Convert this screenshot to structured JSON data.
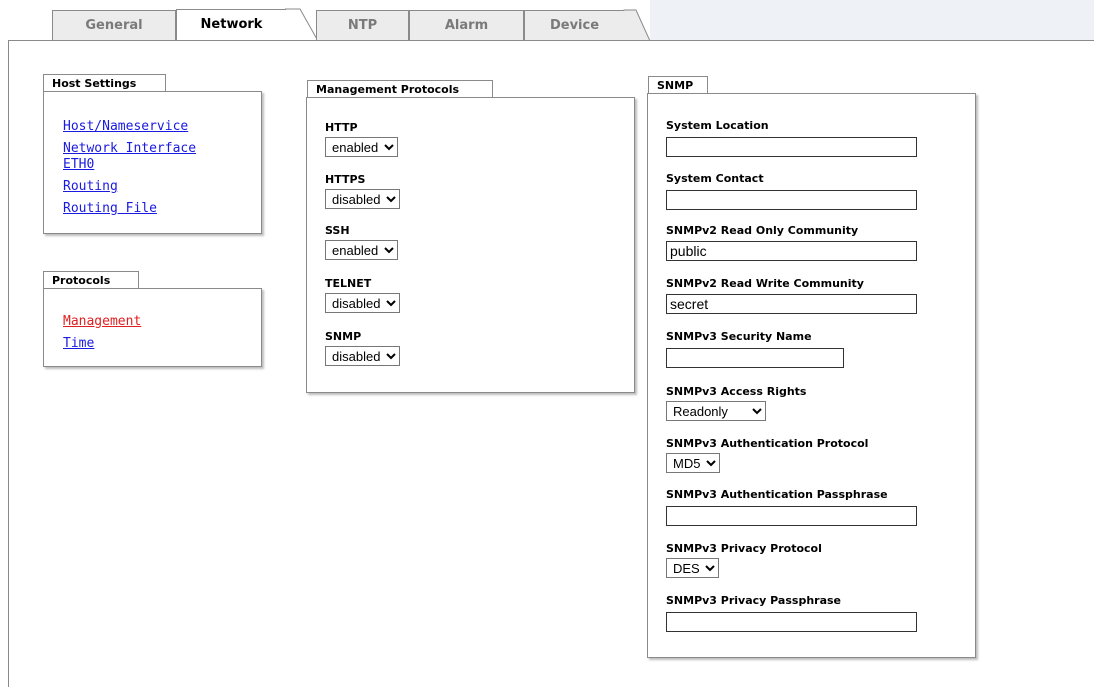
{
  "tabs": [
    {
      "label": "General"
    },
    {
      "label": "Network"
    },
    {
      "label": "NTP"
    },
    {
      "label": "Alarm"
    },
    {
      "label": "Device"
    }
  ],
  "host_settings": {
    "title": "Host Settings",
    "links": [
      "Host/Nameservice",
      "Network Interface",
      "ETH0",
      "Routing",
      "Routing File"
    ]
  },
  "protocols": {
    "title": "Protocols",
    "links": [
      "Management",
      "Time"
    ]
  },
  "management": {
    "title": "Management Protocols",
    "items": [
      {
        "label": "HTTP",
        "value": "enabled"
      },
      {
        "label": "HTTPS",
        "value": "disabled"
      },
      {
        "label": "SSH",
        "value": "enabled"
      },
      {
        "label": "TELNET",
        "value": "disabled"
      },
      {
        "label": "SNMP",
        "value": "disabled"
      }
    ]
  },
  "snmp": {
    "title": "SNMP",
    "system_location": {
      "label": "System Location",
      "value": ""
    },
    "system_contact": {
      "label": "System Contact",
      "value": ""
    },
    "v2_ro": {
      "label": "SNMPv2 Read Only Community",
      "value": "public"
    },
    "v2_rw": {
      "label": "SNMPv2 Read Write Community",
      "value": "secret"
    },
    "v3_secname": {
      "label": "SNMPv3 Security Name",
      "value": ""
    },
    "v3_access": {
      "label": "SNMPv3 Access Rights",
      "value": "Readonly"
    },
    "v3_auth_proto": {
      "label": "SNMPv3 Authentication Protocol",
      "value": "MD5"
    },
    "v3_auth_pass": {
      "label": "SNMPv3 Authentication Passphrase",
      "value": ""
    },
    "v3_priv_proto": {
      "label": "SNMPv3 Privacy Protocol",
      "value": "DES"
    },
    "v3_priv_pass": {
      "label": "SNMPv3 Privacy Passphrase",
      "value": ""
    }
  },
  "colors": {
    "link": "#1a1ae0",
    "link_active": "#e02020",
    "border": "#8a8a8a"
  }
}
